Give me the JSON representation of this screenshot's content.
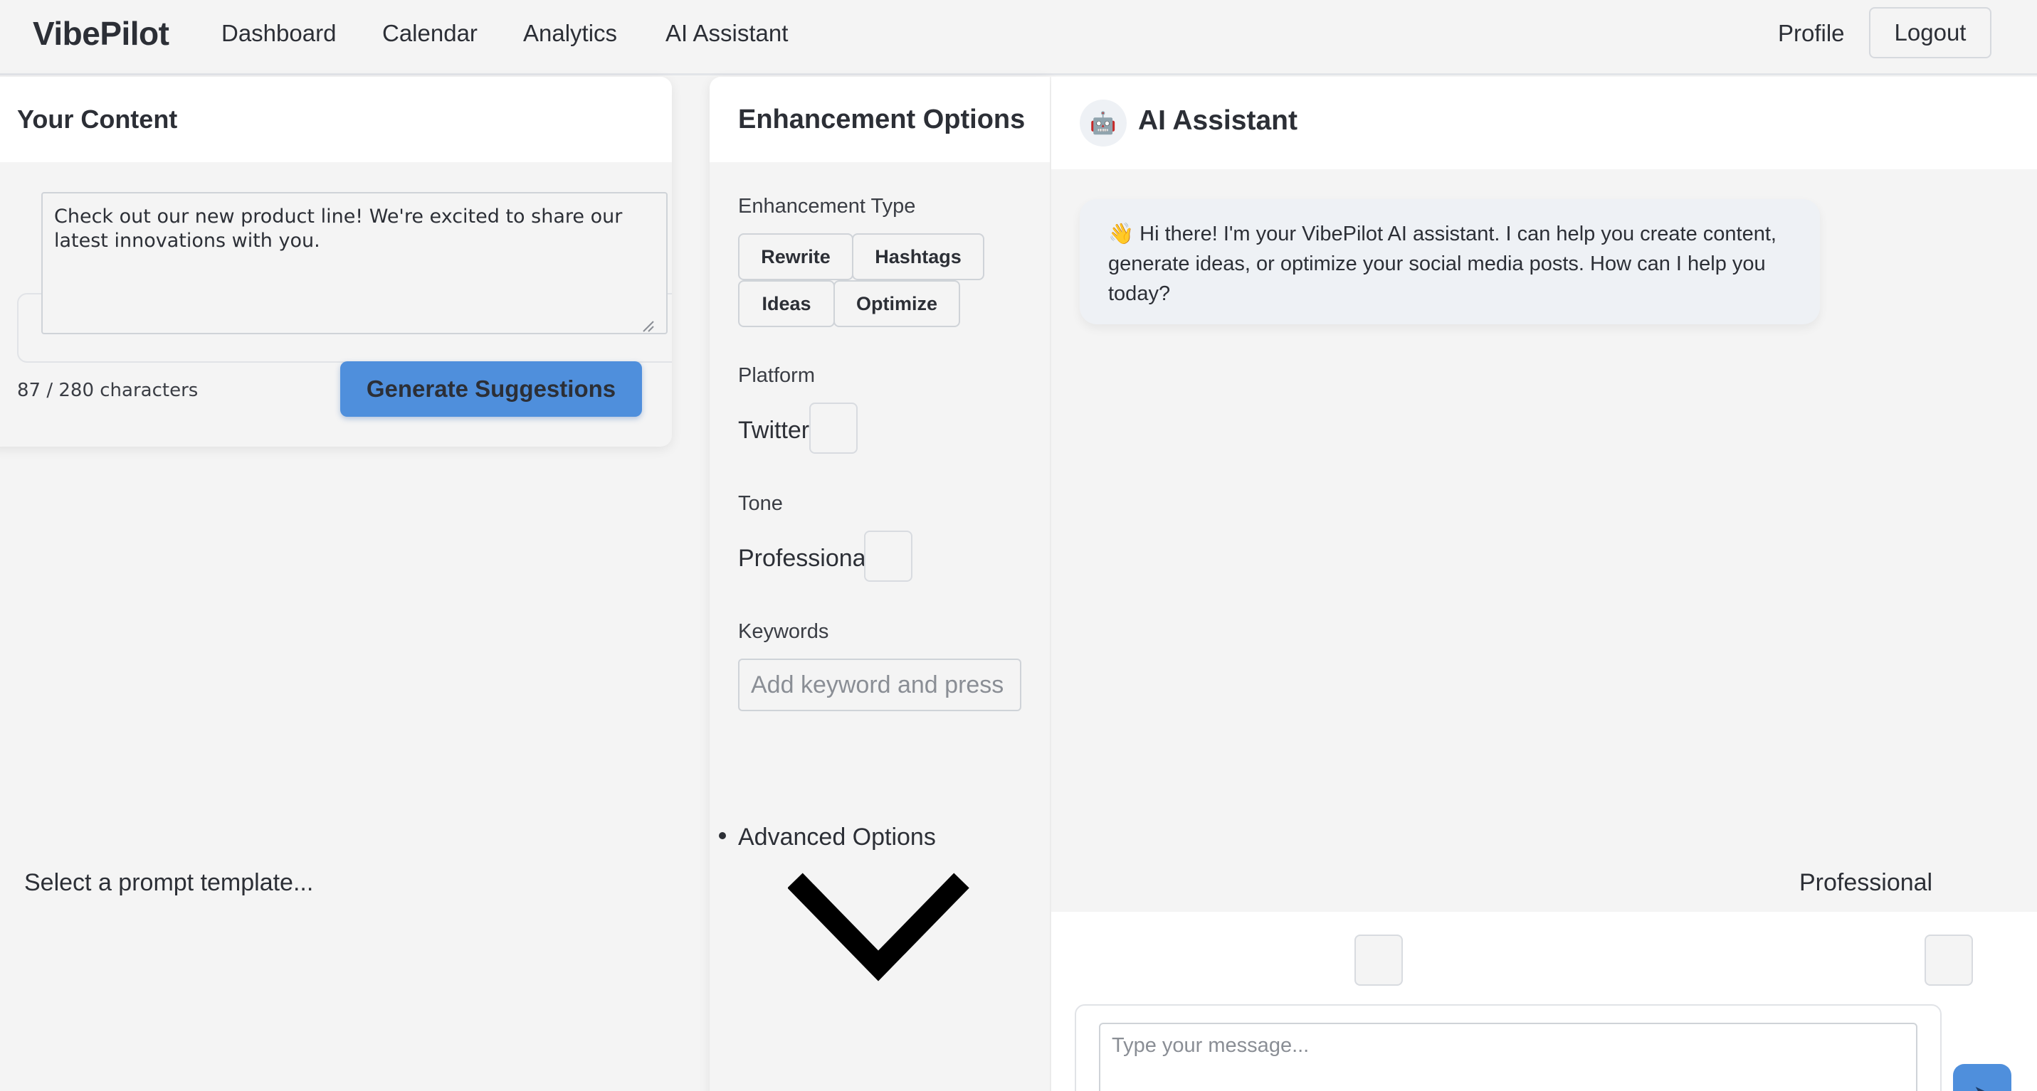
{
  "app": {
    "brand": "VibePilot",
    "nav": [
      "Dashboard",
      "Calendar",
      "Analytics",
      "AI Assistant"
    ],
    "profile": "Profile",
    "logout": "Logout"
  },
  "content_panel": {
    "title": "Your Content",
    "text": "Check out our new product line! We're excited to share our latest innovations with you.",
    "char_count": "87 / 280 characters",
    "generate_label": "Generate Suggestions"
  },
  "enhancement_panel": {
    "title": "Enhancement Options",
    "type_label": "Enhancement Type",
    "types": [
      "Rewrite",
      "Hashtags",
      "Ideas",
      "Optimize"
    ],
    "platform_label": "Platform",
    "platform_value": "Twitter",
    "tone_label": "Tone",
    "tone_value": "Professional",
    "keywords_label": "Keywords",
    "keywords_placeholder": "Add keyword and press Enter",
    "advanced_label": "Advanced Options"
  },
  "ai_panel": {
    "avatar_icon": "🤖",
    "title": "AI Assistant",
    "greeting": "👋 Hi there! I'm your VibePilot AI assistant. I can help you create content, generate ideas, or optimize your social media posts. How can I help you today?",
    "template_placeholder": "Select a prompt template...",
    "tone_value": "Professional",
    "message_placeholder": "Type your message...",
    "send_icon": "send-icon"
  },
  "colors": {
    "accent": "#4f8fdc",
    "background": "#f4f4f4",
    "bubble": "#eef1f5",
    "text": "#2c2f36"
  }
}
